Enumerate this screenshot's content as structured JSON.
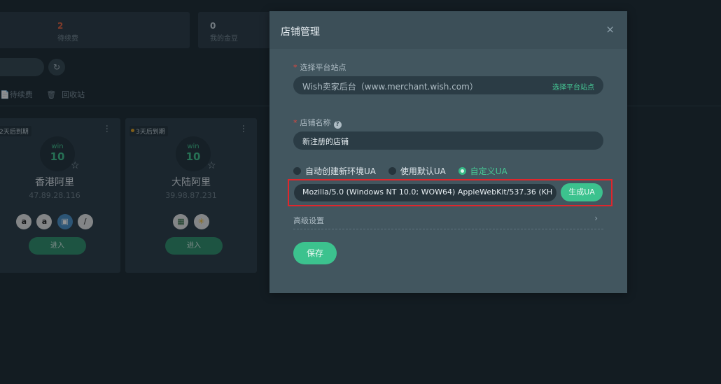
{
  "stats": [
    {
      "num": "2",
      "label": "待续费",
      "num_color": "#e0613f"
    },
    {
      "num": "0",
      "label": "我的金豆",
      "num_color": "#c9d3da"
    }
  ],
  "refresh_icon": "refresh-icon",
  "subtabs": {
    "pending": "待续费",
    "recycle": "回收站"
  },
  "cards": [
    {
      "expire": "2天后到期",
      "win1": "win",
      "win2": "10",
      "name": "香港阿里",
      "ip": "47.89.28.116",
      "enter": "进入"
    },
    {
      "expire": "3天后到期",
      "win1": "win",
      "win2": "10",
      "name": "大陆阿里",
      "ip": "39.98.87.231",
      "enter": "进入"
    }
  ],
  "modal": {
    "title": "店铺管理",
    "close": "×",
    "platform_label": "选择平台站点",
    "platform_value": "Wish卖家后台（www.merchant.wish.com）",
    "platform_link": "选择平台站点",
    "store_label": "店铺名称",
    "store_value": "新注册的店铺",
    "radio_auto": "自动创建新环境UA",
    "radio_default": "使用默认UA",
    "radio_custom": "自定义UA",
    "ua_value": "Mozilla/5.0 (Windows NT 10.0; WOW64) AppleWebKit/537.36 (KH",
    "gen_ua": "生成UA",
    "advanced": "高级设置",
    "save": "保存"
  },
  "colors": {
    "accent": "#3cc28e",
    "highlight_border": "#e0262c",
    "required": "#e0473f"
  }
}
